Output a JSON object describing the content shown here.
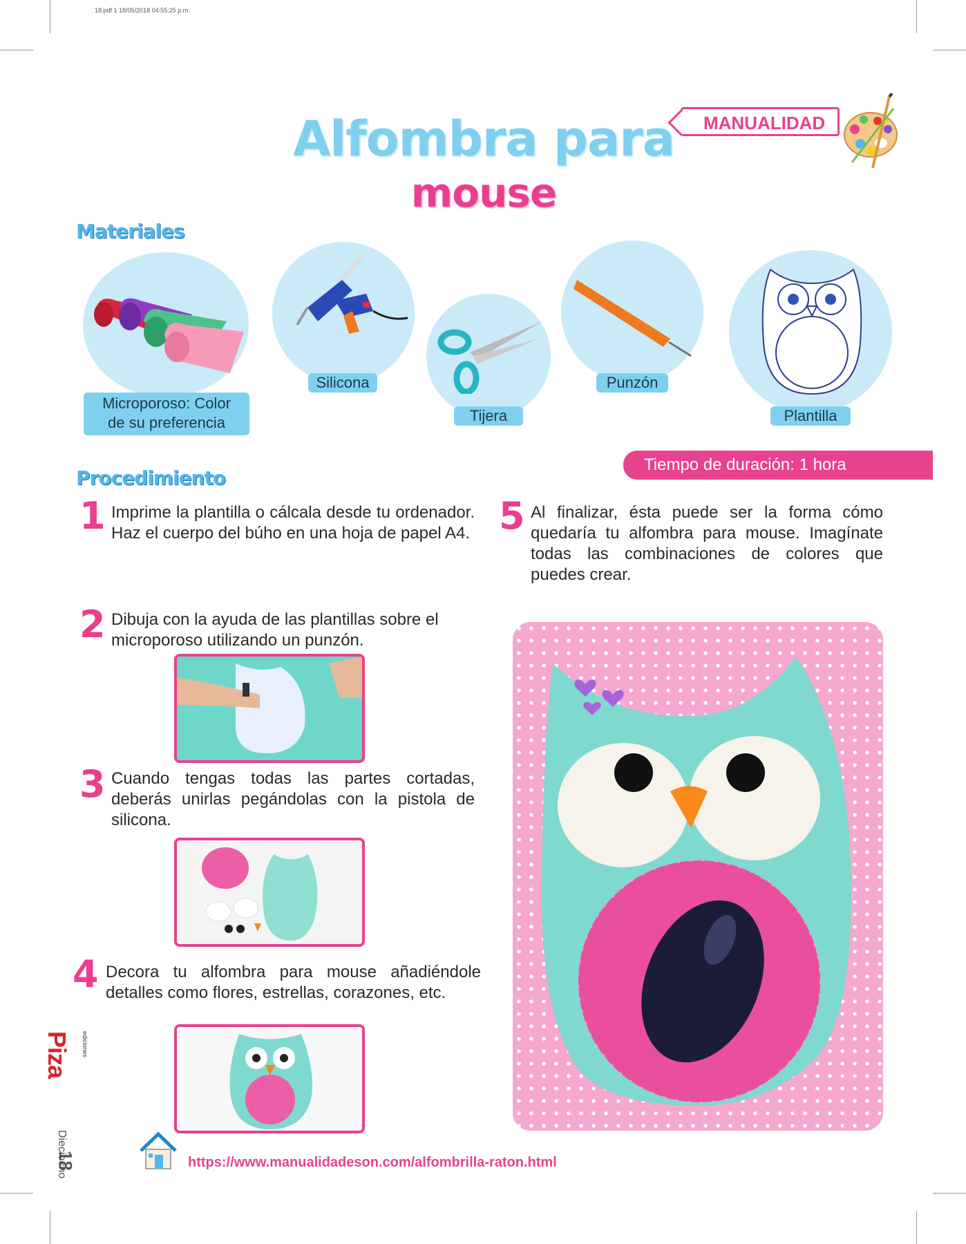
{
  "pdf_info": "18.pdf   1   18/05/2018   04:55:25 p.m.",
  "category_label": "MANUALIDAD",
  "title_line1": "Alfombra para",
  "title_line2": "mouse",
  "materials_heading": "Materiales",
  "materials": [
    {
      "label_line1": "Microporoso: Color",
      "label_line2": "de su preferencia"
    },
    {
      "label": "Silicona"
    },
    {
      "label": "Tijera"
    },
    {
      "label": "Punzón"
    },
    {
      "label": "Plantilla"
    }
  ],
  "procedure_heading": "Procedimiento",
  "duration": "Tiempo de duración: 1 hora",
  "steps": [
    {
      "number": "1",
      "text": "Imprime la plantilla o cálcala desde tu ordenador. Haz el cuerpo del búho en una hoja de papel A4."
    },
    {
      "number": "2",
      "text": "Dibuja con la ayuda de las plantillas sobre el microporoso utilizando un punzón."
    },
    {
      "number": "3",
      "text": "Cuando tengas todas las partes cortadas, deberás unirlas  pegándolas con la pistola de silicona."
    },
    {
      "number": "4",
      "text": "Decora tu alfombra para mouse añadiéndole detalles como flores, estrellas, corazones, etc."
    },
    {
      "number": "5",
      "text": "Al finalizar, ésta puede ser la forma cómo quedaría tu alfombra para mouse. Imagínate todas las combinaciones de colores que puedes crear."
    }
  ],
  "footer": {
    "url": "https://www.manualidadeson.com/alfombrilla-raton.html",
    "page_number": "18",
    "page_word": "Dieciocho",
    "brand": "Piza",
    "brand_sub": "ediciones"
  },
  "colors": {
    "pink": "#e8428d",
    "light_blue": "#7fd0ee",
    "circle_bg": "#cbeaf7",
    "mint": "#7fd9cf"
  }
}
